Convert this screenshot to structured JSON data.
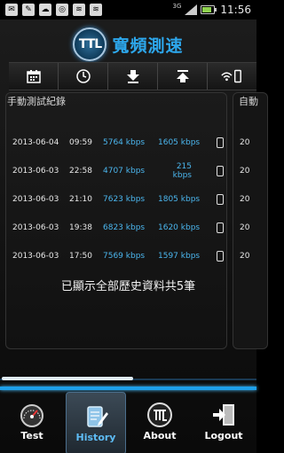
{
  "status": {
    "network_badge": "3G",
    "time": "11:56",
    "icons": [
      "email-icon",
      "messenger-icon",
      "cloud-icon",
      "logo-icon",
      "wifi-icon",
      "wifi-icon-2"
    ]
  },
  "app": {
    "title": "寬頻測速",
    "logo_text": "TTL"
  },
  "toolbar": {
    "icons": [
      "calendar-icon",
      "clock-icon",
      "download-icon",
      "upload-icon",
      "wifi-phone-icon"
    ]
  },
  "history": {
    "title": "手動測試紀錄",
    "second_title": "自動",
    "rows": [
      {
        "date": "2013-06-04",
        "time": "09:59",
        "download": "5764 kbps",
        "upload": "1605 kbps"
      },
      {
        "date": "2013-06-03",
        "time": "22:58",
        "download": "4707 kbps",
        "upload": "215 kbps"
      },
      {
        "date": "2013-06-03",
        "time": "21:10",
        "download": "7623 kbps",
        "upload": "1805 kbps"
      },
      {
        "date": "2013-06-03",
        "time": "19:38",
        "download": "6823 kbps",
        "upload": "1620 kbps"
      },
      {
        "date": "2013-06-03",
        "time": "17:50",
        "download": "7569 kbps",
        "upload": "1597 kbps"
      }
    ],
    "second_rows": [
      "20",
      "20",
      "20",
      "20",
      "20"
    ],
    "summary": "已顯示全部歷史資料共5筆"
  },
  "nav": {
    "items": [
      {
        "label": "Test"
      },
      {
        "label": "History"
      },
      {
        "label": "About"
      },
      {
        "label": "Logout"
      }
    ]
  },
  "colors": {
    "accent": "#2da7ec",
    "value_blue": "#4bb6ee"
  }
}
